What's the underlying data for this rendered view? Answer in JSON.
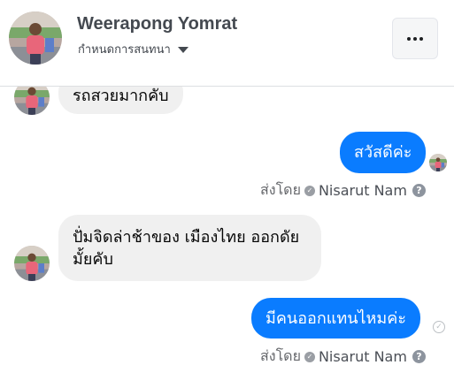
{
  "header": {
    "name": "Weerapong Yomrat",
    "subtitle": "กำหนดการสนทนา"
  },
  "messages": [
    {
      "direction": "incoming",
      "text": "รถสวยมากคับ"
    },
    {
      "direction": "outgoing",
      "text": "สวัสดีค่ะ",
      "sent_by_label": "ส่งโดย",
      "sender": "Nisarut Nam"
    },
    {
      "direction": "incoming",
      "text": "ปั่มจิดล่าช้าของ เมืองไทย ออกดัยมั้ยคับ"
    },
    {
      "direction": "outgoing",
      "text": "มีคนออกแทนไหมค่ะ",
      "sent_by_label": "ส่งโดย",
      "sender": "Nisarut Nam"
    }
  ],
  "colors": {
    "outgoing_bubble": "#0a7cff",
    "incoming_bubble": "#f0f0f0"
  },
  "icons": {
    "more": "more-horizontal-icon",
    "dropdown": "caret-down-icon",
    "info": "question-circle-icon",
    "sent_status": "check-circle-icon"
  }
}
